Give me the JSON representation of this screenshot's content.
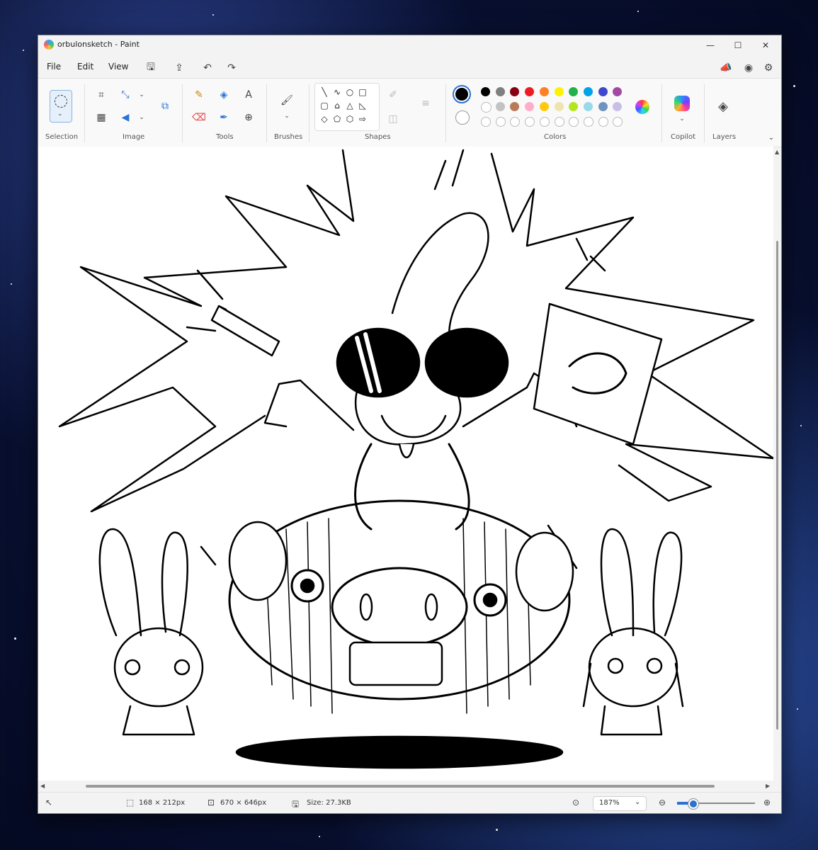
{
  "window": {
    "title": "orbulonsketch - Paint"
  },
  "window_controls": {
    "minimize": "—",
    "maximize": "☐",
    "close": "✕"
  },
  "menu": {
    "file": "File",
    "edit": "Edit",
    "view": "View"
  },
  "ribbon": {
    "groups": {
      "selection": "Selection",
      "image": "Image",
      "tools": "Tools",
      "brushes": "Brushes",
      "shapes": "Shapes",
      "colors": "Colors",
      "copilot": "Copilot",
      "layers": "Layers"
    },
    "palette_row1": [
      "#000000",
      "#7f7f7f",
      "#880015",
      "#ed1c24",
      "#ff7f27",
      "#fff200",
      "#22b14c",
      "#00a2e8",
      "#3f48cc",
      "#a349a4"
    ],
    "palette_row2": [
      "#ffffff",
      "#c3c3c3",
      "#b97a57",
      "#ffaec9",
      "#ffc90e",
      "#efe4b0",
      "#b5e61d",
      "#99d9ea",
      "#7092be",
      "#c8bfe7"
    ],
    "primary_color": "#000000",
    "secondary_color": "#ffffff"
  },
  "status": {
    "selection_size": "168 × 212px",
    "canvas_size": "670 × 646px",
    "file_size": "Size: 27.3KB",
    "zoom": "187%"
  },
  "zoom_slider_fraction": 0.2
}
